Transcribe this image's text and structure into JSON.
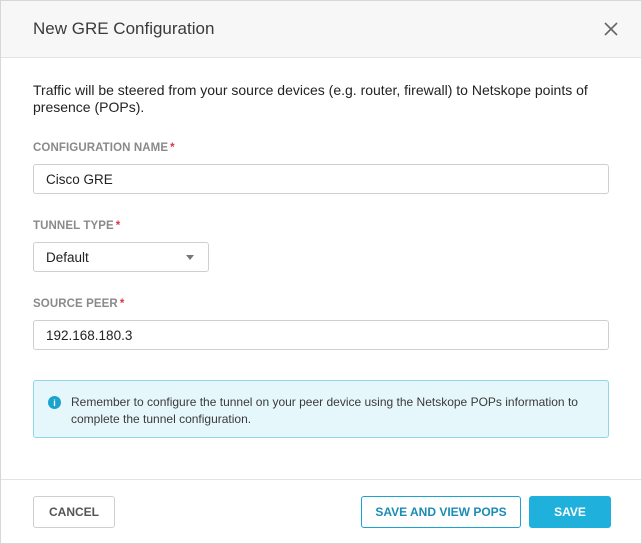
{
  "dialog": {
    "title": "New GRE Configuration",
    "intro": "Traffic will be steered from your source devices (e.g. router, firewall) to Netskope points of presence (POPs).",
    "fields": {
      "config_name": {
        "label": "CONFIGURATION NAME",
        "required_mark": "*",
        "value": "Cisco GRE"
      },
      "tunnel_type": {
        "label": "TUNNEL TYPE",
        "required_mark": "*",
        "value": "Default"
      },
      "source_peer": {
        "label": "SOURCE PEER",
        "required_mark": "*",
        "value": "192.168.180.3"
      }
    },
    "alert": {
      "icon": "info-icon",
      "text": "Remember to configure the tunnel on your peer device using the Netskope POPs information to complete the tunnel configuration."
    },
    "buttons": {
      "cancel": "CANCEL",
      "save_view_pops": "SAVE AND VIEW POPS",
      "save": "SAVE"
    },
    "colors": {
      "accent": "#1fb0dc",
      "required": "#e0334a",
      "alert_bg": "#e6f7fb",
      "alert_border": "#8fd6e8"
    }
  }
}
